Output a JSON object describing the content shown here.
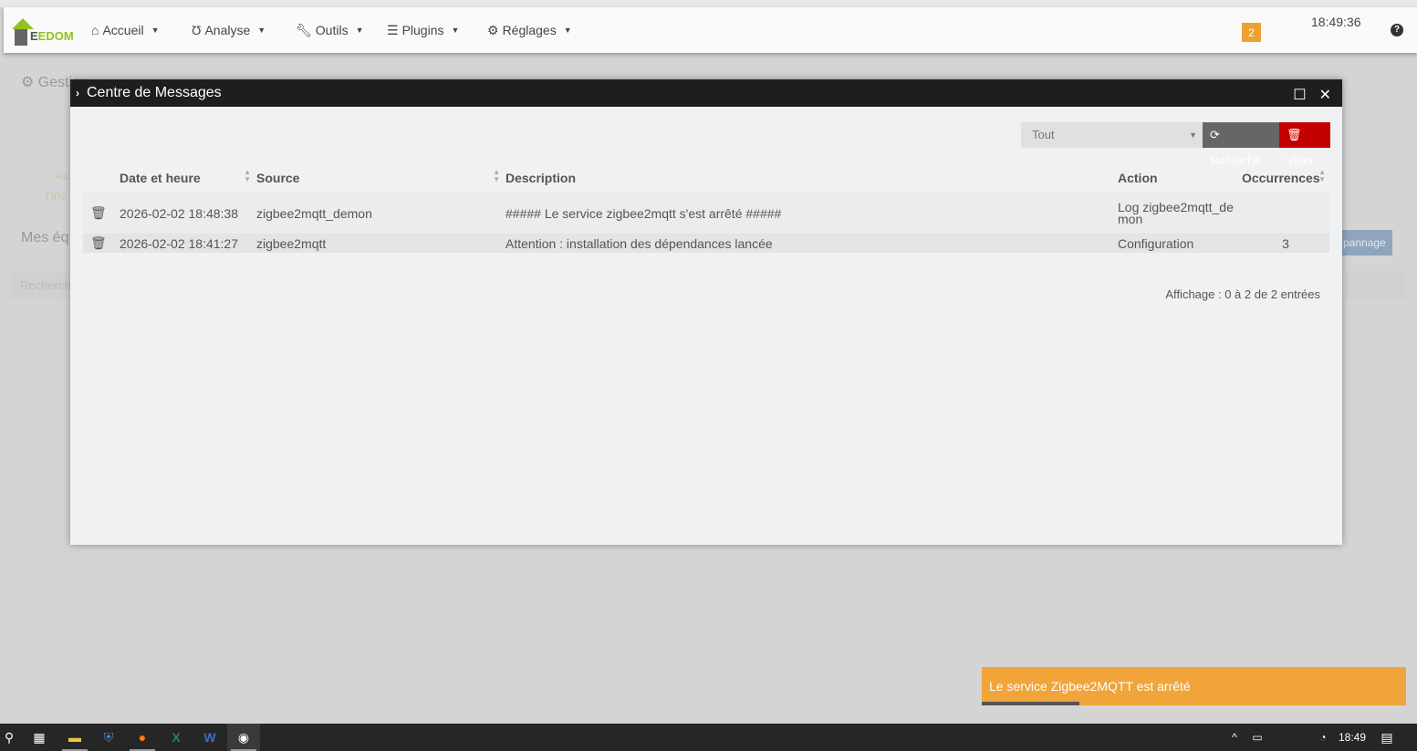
{
  "nav": {
    "logo": "JEEDOM",
    "items": [
      {
        "label": "Accueil",
        "icon": "home-icon"
      },
      {
        "label": "Analyse",
        "icon": "stethoscope-icon"
      },
      {
        "label": "Outils",
        "icon": "wrench-icon"
      },
      {
        "label": "Plugins",
        "icon": "list-icon"
      },
      {
        "label": "Réglages",
        "icon": "gear-icon"
      }
    ],
    "badge": "2",
    "clock": "18:49:36",
    "help": "?"
  },
  "background": {
    "title": "Gestion",
    "item1": "Ac",
    "item2": "l'inc",
    "section": "Mes éq",
    "search_placeholder": "Recherch",
    "button": "pannage"
  },
  "modal": {
    "title": "Centre de Messages",
    "filter": "Tout",
    "refresh": "Rafraichir",
    "clear": "Vider",
    "columns": [
      "Date et heure",
      "Source",
      "Description",
      "Action",
      "Occurrences"
    ],
    "rows": [
      {
        "date": "2026-02-02 18:48:38",
        "source": "zigbee2mqtt_demon",
        "description": "##### Le service zigbee2mqtt s'est arrêté #####",
        "action": "Log zigbee2mqtt_demon",
        "occurrences": ""
      },
      {
        "date": "2026-02-02 18:41:27",
        "source": "zigbee2mqtt",
        "description": "Attention : installation des dépendances lancée",
        "action": "Configuration",
        "occurrences": "3"
      }
    ],
    "info": "Affichage : 0 à 2 de 2 entrées"
  },
  "toast": {
    "message": "Le service Zigbee2MQTT est arrêté",
    "progress": 0.23
  },
  "taskbar": {
    "time": "18:49"
  }
}
